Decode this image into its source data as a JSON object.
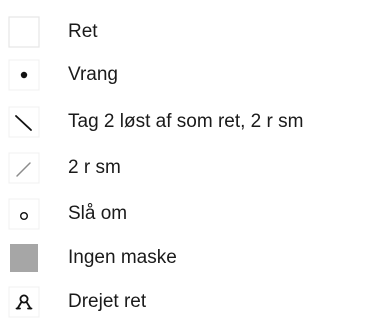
{
  "legend": {
    "items": [
      {
        "symbol": "empty-square-icon",
        "label": "Ret"
      },
      {
        "symbol": "dot-icon",
        "label": "Vrang"
      },
      {
        "symbol": "backslash-icon",
        "label": "Tag 2 løst af som ret, 2 r sm"
      },
      {
        "symbol": "slash-icon",
        "label": "2 r sm"
      },
      {
        "symbol": "small-circle-icon",
        "label": "Slå om"
      },
      {
        "symbol": "filled-gray-square-icon",
        "label": "Ingen maske"
      },
      {
        "symbol": "twisted-stitch-icon",
        "label": "Drejet ret"
      }
    ],
    "colors": {
      "text": "#1a1a1a",
      "symbol_border": "#e6e6e6",
      "symbol_ink": "#111111",
      "slash_gray": "#8c8c8c",
      "no_stitch_fill": "#a6a6a6"
    }
  }
}
